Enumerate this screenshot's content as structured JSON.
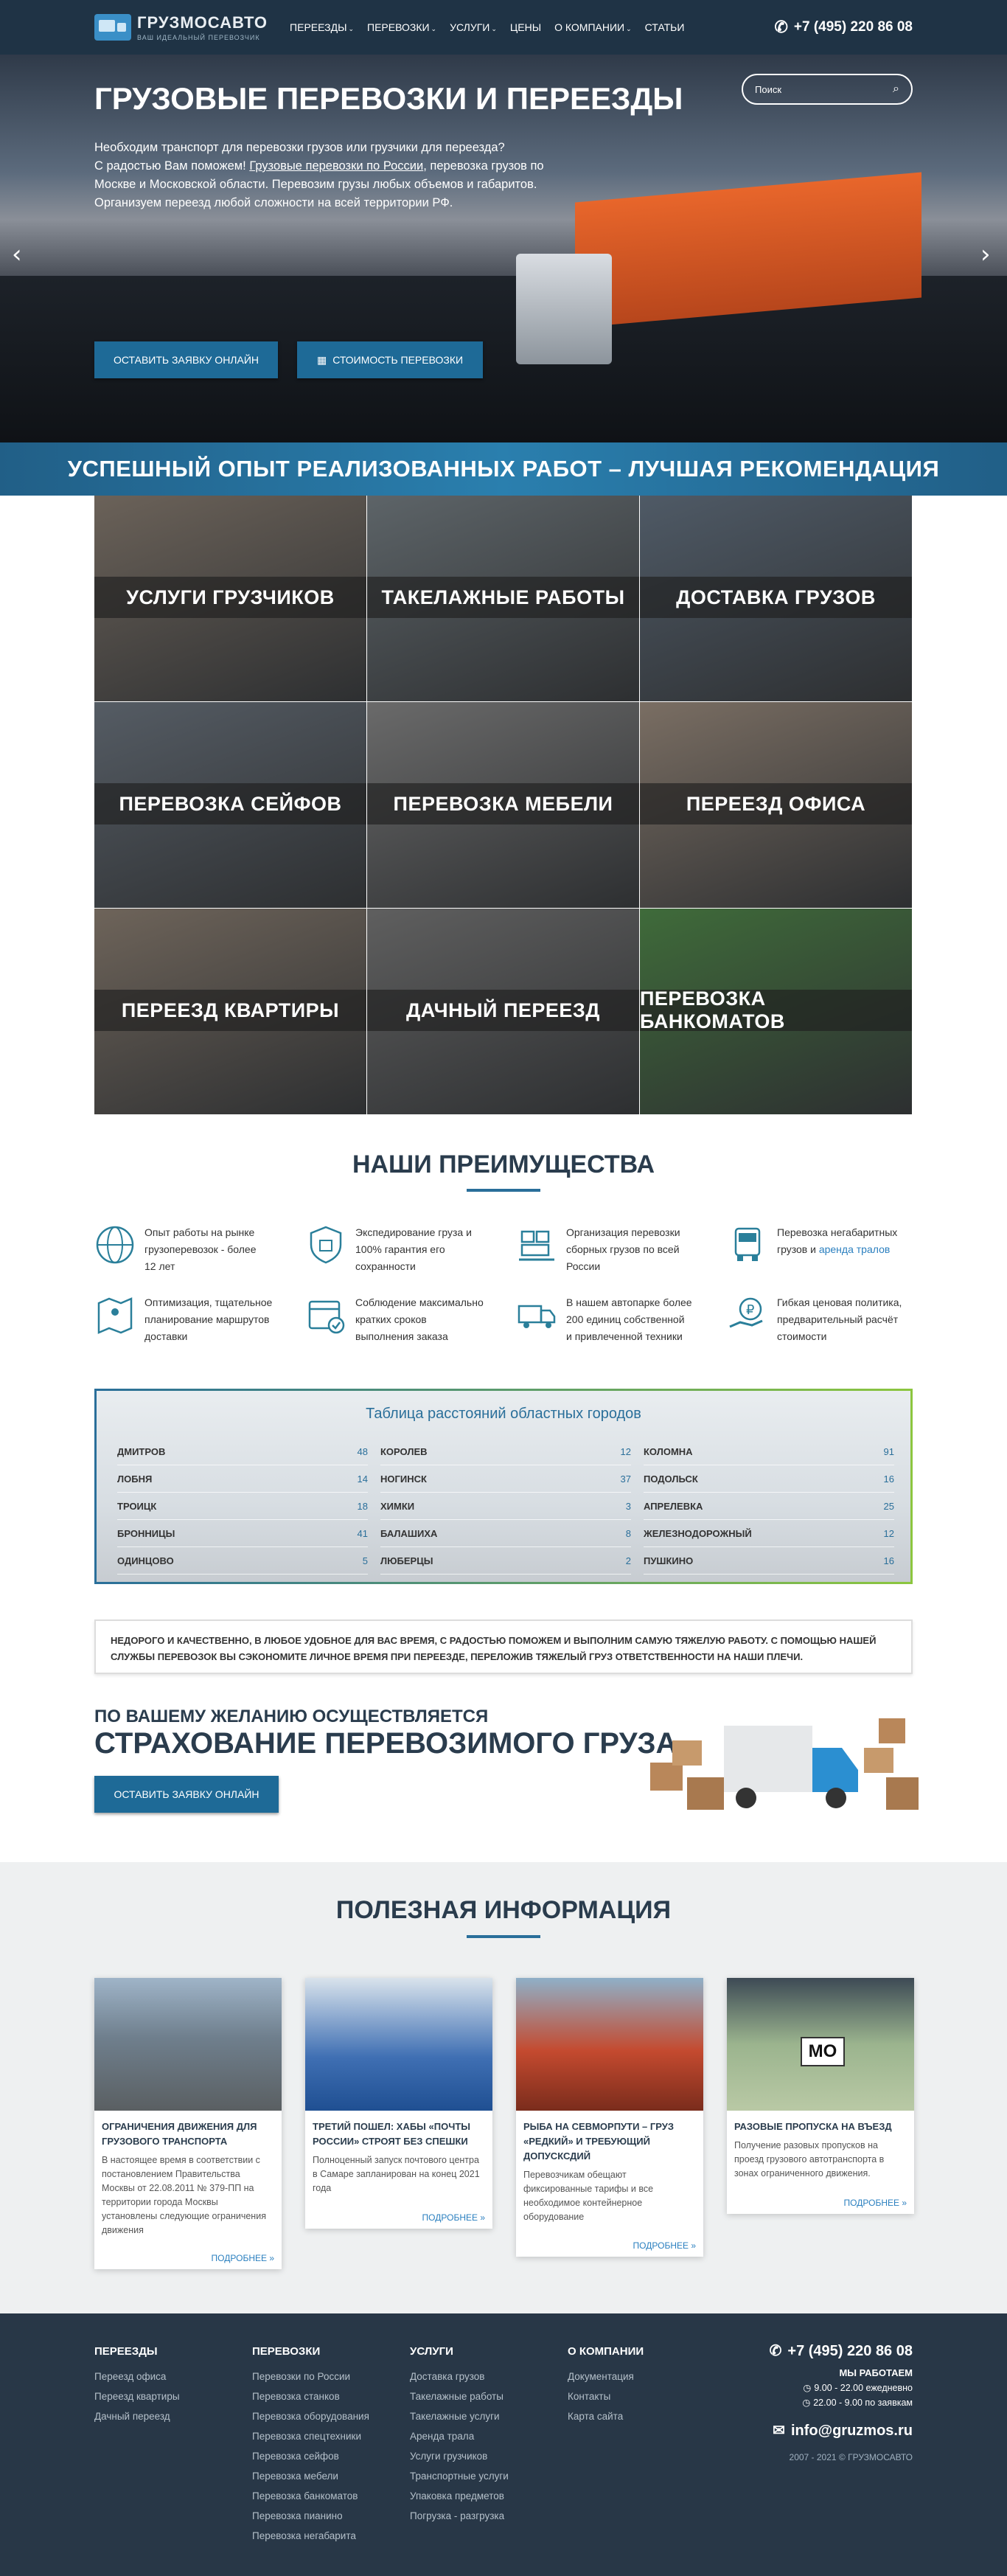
{
  "header": {
    "logo_name": "ГРУЗМОСАВТО",
    "logo_slogan": "ВАШ ИДЕАЛЬНЫЙ ПЕРЕВОЗЧИК",
    "nav": [
      {
        "label": "ПЕРЕЕЗДЫ",
        "dropdown": true
      },
      {
        "label": "ПЕРЕВОЗКИ",
        "dropdown": true
      },
      {
        "label": "УСЛУГИ",
        "dropdown": true
      },
      {
        "label": "ЦЕНЫ",
        "dropdown": false
      },
      {
        "label": "О КОМПАНИИ",
        "dropdown": true
      },
      {
        "label": "СТАТЬИ",
        "dropdown": false
      }
    ],
    "phone": "+7 (495) 220 86 08"
  },
  "hero": {
    "search_placeholder": "Поиск",
    "title": "ГРУЗОВЫЕ ПЕРЕВОЗКИ И ПЕРЕЕЗДЫ",
    "text_1": "Необходим транспорт для перевозки грузов или грузчики для переезда?",
    "text_2a": "С радостью Вам поможем! ",
    "text_2_link": "Грузовые перевозки по России",
    "text_2b": ", перевозка грузов по",
    "text_3": "Москве и Московской области. Перевозим грузы любых объемов и габаритов.",
    "text_4": "Организуем переезд любой сложности на всей территории РФ.",
    "btn_request": "ОСТАВИТЬ ЗАЯВКУ ОНЛАЙН",
    "btn_price": "СТОИМОСТЬ ПЕРЕВОЗКИ",
    "arrow_left": "‹",
    "arrow_right": "›"
  },
  "banner": "УСПЕШНЫЙ ОПЫТ РЕАЛИЗОВАННЫХ РАБОТ – ЛУЧШАЯ РЕКОМЕНДАЦИЯ",
  "services": [
    {
      "label": "УСЛУГИ ГРУЗЧИКОВ",
      "color": "#6b6259"
    },
    {
      "label": "ТАКЕЛАЖНЫЕ РАБОТЫ",
      "color": "#5d6468"
    },
    {
      "label": "ДОСТАВКА ГРУЗОВ",
      "color": "#4f5a66"
    },
    {
      "label": "ПЕРЕВОЗКА СЕЙФОВ",
      "color": "#555c64"
    },
    {
      "label": "ПЕРЕВОЗКА МЕБЕЛИ",
      "color": "#6a6a6a"
    },
    {
      "label": "ПЕРЕЕЗД ОФИСА",
      "color": "#7a6e63"
    },
    {
      "label": "ПЕРЕЕЗД КВАРТИРЫ",
      "color": "#6e645a"
    },
    {
      "label": "ДАЧНЫЙ ПЕРЕЕЗД",
      "color": "#5f5f5f"
    },
    {
      "label": "ПЕРЕВОЗКА БАНКОМАТОВ",
      "color": "#3f6b3a"
    }
  ],
  "advantages": {
    "title": "НАШИ ПРЕИМУЩЕСТВА",
    "items": [
      {
        "icon": "globe-icon",
        "lines": [
          "Опыт работы на рынке",
          "грузоперевозок - более",
          "12 лет"
        ]
      },
      {
        "icon": "shield-icon",
        "lines": [
          "Экспедирование груза и",
          "100% гарантия его",
          "сохранности"
        ]
      },
      {
        "icon": "pallet-icon",
        "lines": [
          "Организация перевозки",
          "сборных грузов по всей",
          "России"
        ]
      },
      {
        "icon": "truck-front-icon",
        "lines": [
          "Перевозка негабаритных",
          "грузов и "
        ],
        "link": "аренда тралов"
      },
      {
        "icon": "map-route-icon",
        "lines": [
          "Оптимизация, тщательное",
          "планирование маршрутов",
          "доставки"
        ]
      },
      {
        "icon": "calendar-check-icon",
        "lines": [
          "Соблюдение максимально",
          "кратких сроков",
          "выполнения заказа"
        ]
      },
      {
        "icon": "truck-side-icon",
        "lines": [
          "В нашем автопарке более",
          "200 единиц собственной",
          "и привлеченной техники"
        ]
      },
      {
        "icon": "ruble-hand-icon",
        "lines": [
          "Гибкая ценовая политика,",
          "предварительный расчёт",
          "стоимости"
        ]
      }
    ]
  },
  "distances": {
    "title": "Таблица расстояний областных городов",
    "columns": [
      [
        [
          "ДМИТРОВ",
          "48"
        ],
        [
          "ЛОБНЯ",
          "14"
        ],
        [
          "ТРОИЦК",
          "18"
        ],
        [
          "БРОННИЦЫ",
          "41"
        ],
        [
          "ОДИНЦОВО",
          "5"
        ]
      ],
      [
        [
          "КОРОЛЕВ",
          "12"
        ],
        [
          "НОГИНСК",
          "37"
        ],
        [
          "ХИМКИ",
          "3"
        ],
        [
          "БАЛАШИХА",
          "8"
        ],
        [
          "ЛЮБЕРЦЫ",
          "2"
        ]
      ],
      [
        [
          "КОЛОМНА",
          "91"
        ],
        [
          "ПОДОЛЬСК",
          "16"
        ],
        [
          "АПРЕЛЕВКА",
          "25"
        ],
        [
          "ЖЕЛЕЗНОДОРОЖНЫЙ",
          "12"
        ],
        [
          "ПУШКИНО",
          "16"
        ]
      ]
    ]
  },
  "quote": "НЕДОРОГО И КАЧЕСТВЕННО, В ЛЮБОЕ УДОБНОЕ ДЛЯ ВАС ВРЕМЯ, С РАДОСТЬЮ ПОМОЖЕМ И ВЫПОЛНИМ САМУЮ ТЯЖЕЛУЮ РАБОТУ. С ПОМОЩЬЮ НАШЕЙ СЛУЖБЫ ПЕРЕВОЗОК ВЫ СЭКОНОМИТЕ ЛИЧНОЕ ВРЕМЯ ПРИ ПЕРЕЕЗДЕ, ПЕРЕЛОЖИВ ТЯЖЕЛЫЙ ГРУЗ ОТВЕТСТВЕННОСТИ НА НАШИ ПЛЕЧИ.",
  "insurance": {
    "subtitle": "ПО ВАШЕМУ ЖЕЛАНИЮ ОСУЩЕСТВЛЯЕТСЯ",
    "title": "СТРАХОВАНИЕ ПЕРЕВОЗИМОГО ГРУЗА",
    "button": "ОСТАВИТЬ ЗАЯВКУ ОНЛАЙН"
  },
  "info": {
    "title": "ПОЛЕЗНАЯ ИНФОРМАЦИЯ",
    "more": "ПОДРОБНЕЕ »",
    "cards": [
      {
        "title": "ОГРАНИЧЕНИЯ ДВИЖЕНИЯ ДЛЯ ГРУЗОВОГО ТРАНСПОРТА",
        "text": "В настоящее время в соответствии с постановлением Правительства Москвы от 22.08.2011 № 379-ПП на территории города Москвы установлены следующие ограничения движения"
      },
      {
        "title": "ТРЕТИЙ ПОШЕЛ: ХАБЫ «ПОЧТЫ РОССИИ» СТРОЯТ БЕЗ СПЕШКИ",
        "text": "Полноценный запуск почтового центра в Самаре запланирован на конец 2021 года"
      },
      {
        "title": "РЫБА НА СЕВМОРПУТИ – ГРУЗ «РЕДКИЙ» И ТРЕБУЮЩИЙ ДОПУСКСДИЙ",
        "text": "Перевозчикам обещают фиксированные тарифы и все необходимое контейнерное оборудование"
      },
      {
        "title": "РАЗОВЫЕ ПРОПУСКА НА ВЪЕЗД",
        "text": "Получение разовых пропусков на проезд грузового автотранспорта в зонах ограниченного движения."
      }
    ],
    "pass_label": "МО"
  },
  "footer": {
    "columns": [
      {
        "title": "ПЕРЕЕЗДЫ",
        "links": [
          "Переезд офиса",
          "Переезд квартиры",
          "Дачный переезд"
        ]
      },
      {
        "title": "ПЕРЕВОЗКИ",
        "links": [
          "Перевозки по России",
          "Перевозка станков",
          "Перевозка оборудования",
          "Перевозка спецтехники",
          "Перевозка сейфов",
          "Перевозка мебели",
          "Перевозка банкоматов",
          "Перевозка пианино",
          "Перевозка негабарита"
        ]
      },
      {
        "title": "УСЛУГИ",
        "links": [
          "Доставка грузов",
          "Такелажные работы",
          "Такелажные услуги",
          "Аренда трала",
          "Услуги грузчиков",
          "Транспортные услуги",
          "Упаковка предметов",
          "Погрузка - разгрузка"
        ]
      },
      {
        "title": "О КОМПАНИИ",
        "links": [
          "Документация",
          "Контакты",
          "Карта сайта"
        ]
      }
    ],
    "phone": "+7 (495) 220 86 08",
    "work_title": "МЫ РАБОТАЕМ",
    "hours_1": "9.00 - 22.00 ежедневно",
    "hours_2": "22.00 - 9.00 по заявкам",
    "email": "info@gruzmos.ru",
    "copyright": "2007 - 2021 © ГРУЗМОСАВТО"
  }
}
